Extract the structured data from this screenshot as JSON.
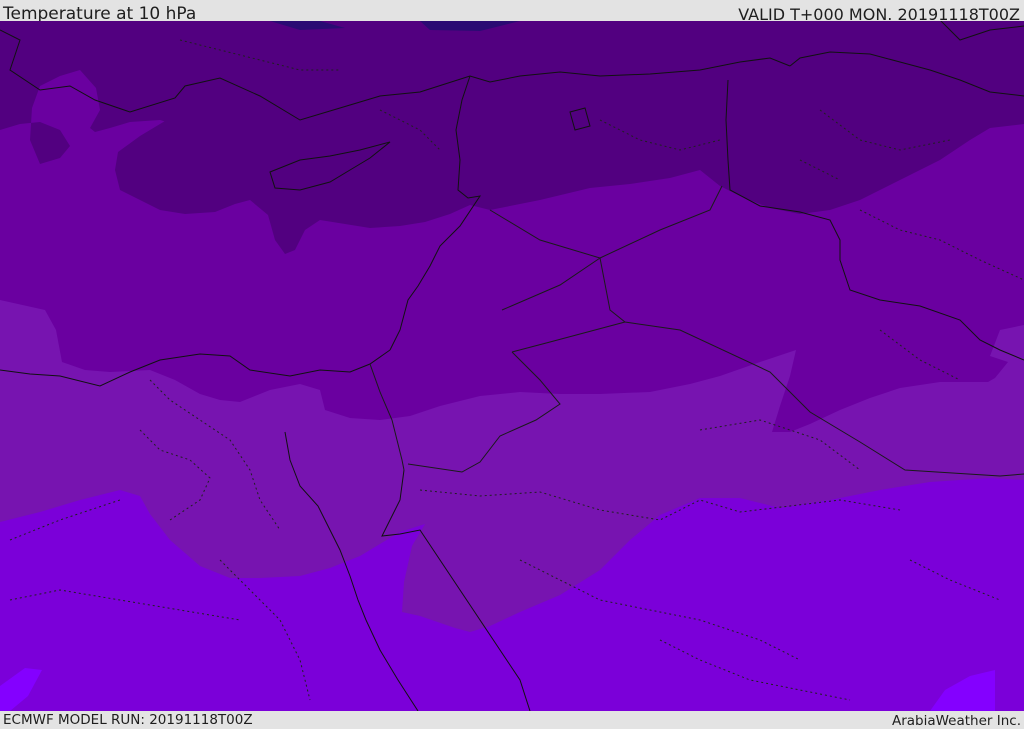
{
  "header": {
    "title": "Temperature at 10 hPa",
    "valid": "VALID T+000 MON. 20191118T00Z"
  },
  "footer": {
    "model_run": "ECMWF MODEL RUN: 20191118T00Z",
    "brand": "ArabiaWeather Inc."
  },
  "colors": {
    "band_coldest": "#2a0b73",
    "band_1": "#520080",
    "band_2": "#6a00a0",
    "band_3": "#7714b0",
    "band_4": "#7b00d9",
    "band_5": "#8400ff",
    "land_border": "#111111",
    "country_border": "#1a1a1a"
  }
}
